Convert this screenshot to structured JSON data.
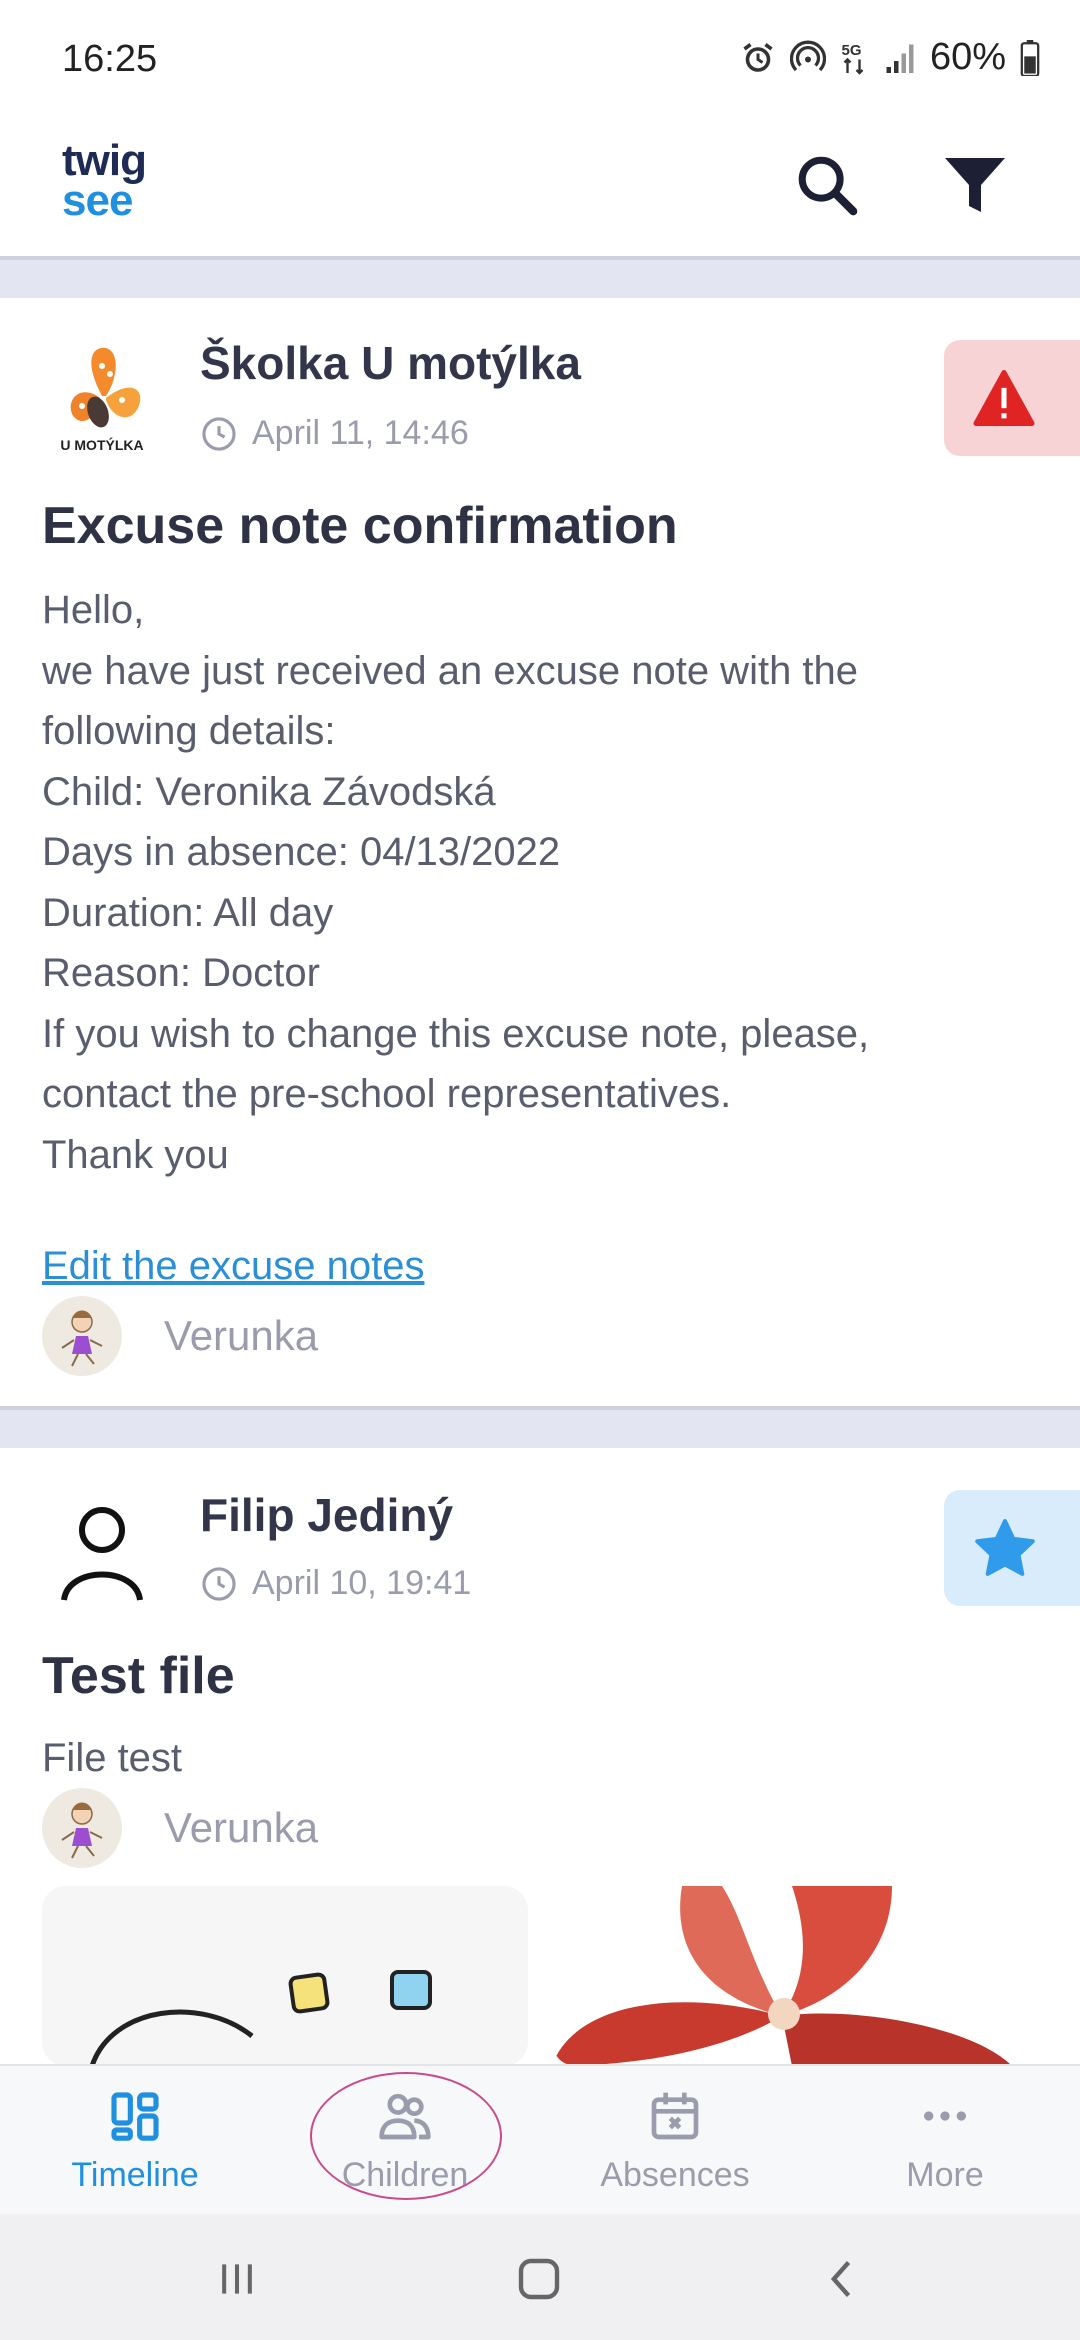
{
  "status_bar": {
    "time": "16:25",
    "battery": "60%"
  },
  "app": {
    "logo_top": "twig",
    "logo_bottom": "see"
  },
  "posts": [
    {
      "author": "Školka U motýlka",
      "avatar_text": "U MOTÝLKA",
      "date": "April 11, 14:46",
      "title": "Excuse note confirmation",
      "body": [
        "Hello,",
        "we have just received an excuse note with the",
        "following details:",
        "Child: Veronika Závodská",
        "Days in absence: 04/13/2022",
        "Duration: All day",
        "Reason: Doctor",
        "If you wish to change this excuse note, please,",
        "contact the pre-school representatives.",
        "Thank you"
      ],
      "link": "Edit the excuse notes",
      "child": "Verunka",
      "badge": "alert-icon",
      "badge_color": "#e02424"
    },
    {
      "author": "Filip Jediný",
      "date": "April 10, 19:41",
      "title": "Test file",
      "body": [
        "File test"
      ],
      "child": "Verunka",
      "badge": "star-icon",
      "badge_color": "#2f9bea"
    }
  ],
  "bottom_nav": [
    {
      "label": "Timeline",
      "icon": "timeline-icon",
      "active": true
    },
    {
      "label": "Children",
      "icon": "children-icon",
      "active": false
    },
    {
      "label": "Absences",
      "icon": "calendar-icon",
      "active": false
    },
    {
      "label": "More",
      "icon": "more-icon",
      "active": false
    }
  ],
  "colors": {
    "accent": "#1f8fe0",
    "separator": "#e4e5f2",
    "alert_bg": "#f8d3d6",
    "star_bg": "#d8ecfb"
  }
}
